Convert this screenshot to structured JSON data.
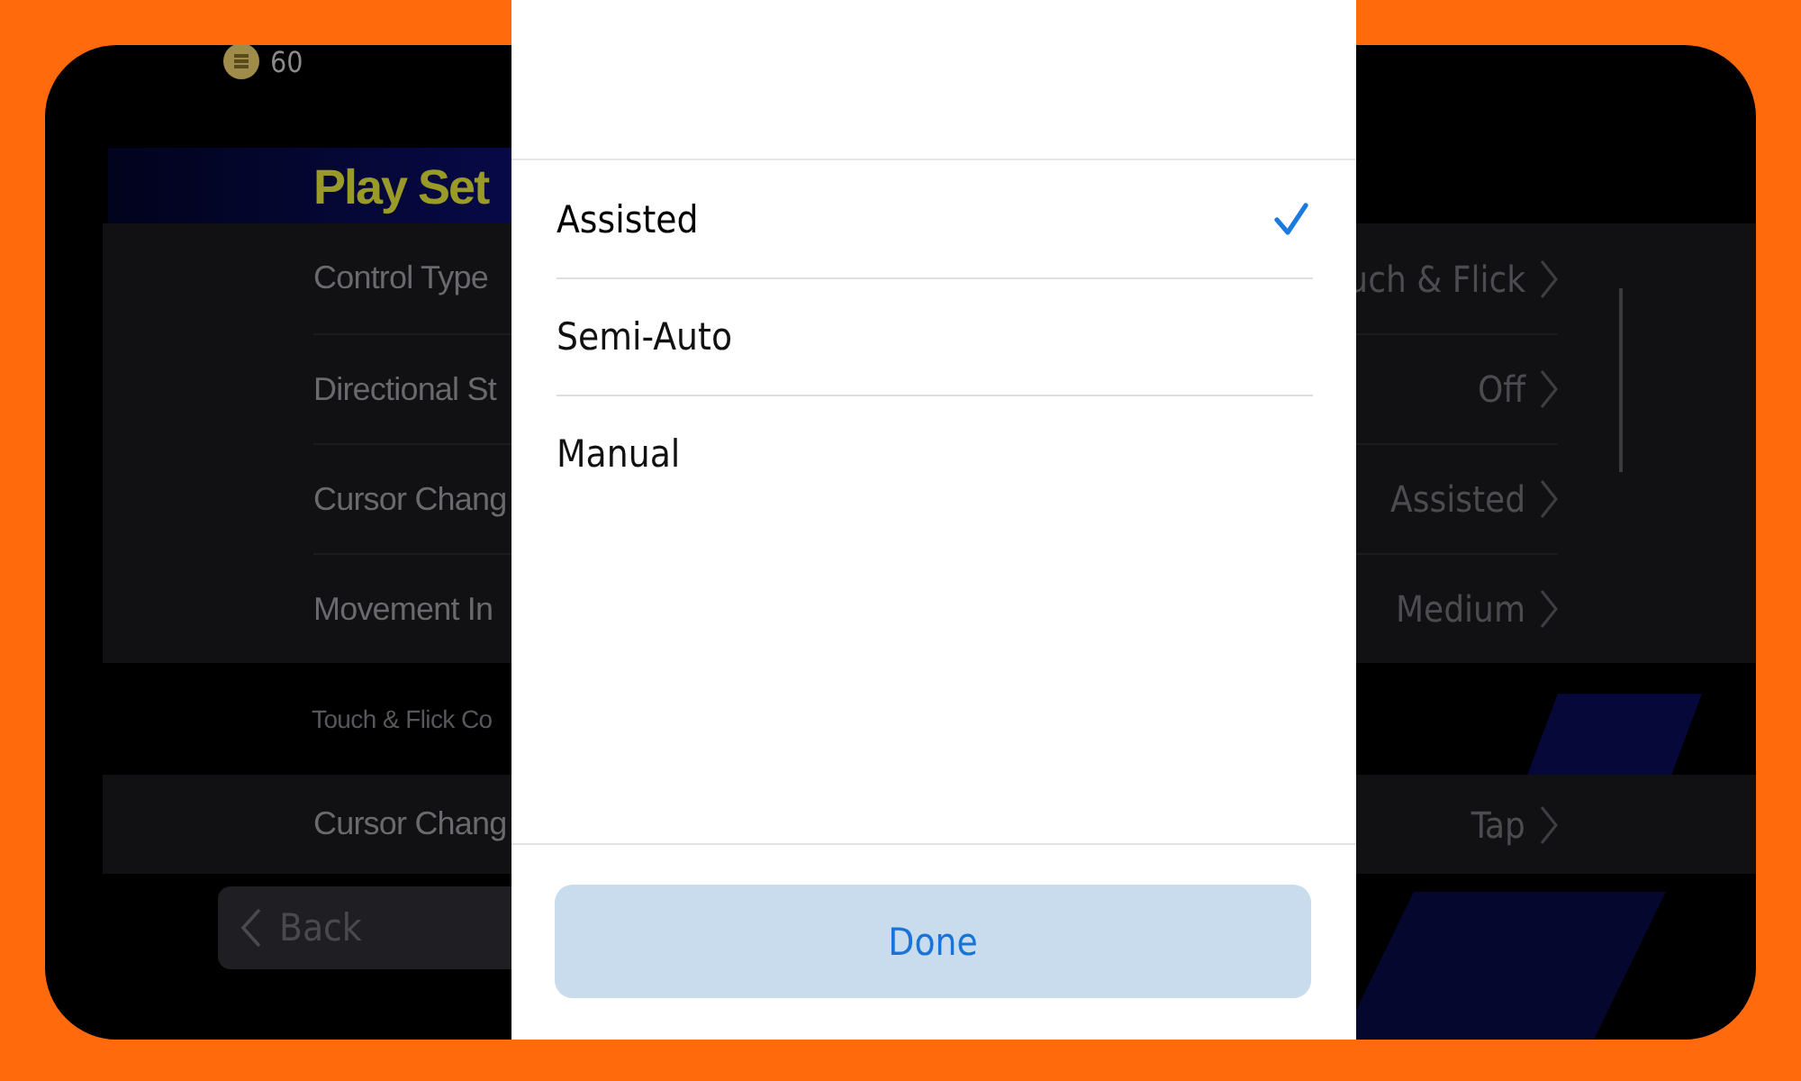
{
  "status": {
    "coins": "60"
  },
  "title": "Play Set",
  "settings": [
    {
      "label": "Control Type",
      "value": "uch & Flick"
    },
    {
      "label": "Directional St",
      "value": "Off"
    },
    {
      "label": "Cursor Chang",
      "value": "Assisted"
    },
    {
      "label": "Movement In",
      "value": "Medium"
    }
  ],
  "section": {
    "heading": "Touch & Flick Co",
    "settings": [
      {
        "label": "Cursor Chang",
        "value": "Tap"
      }
    ]
  },
  "back_button": "Back",
  "picker": {
    "options": [
      {
        "label": "Assisted",
        "selected": true
      },
      {
        "label": "Semi-Auto",
        "selected": false
      },
      {
        "label": "Manual",
        "selected": false
      }
    ],
    "done_button": "Done"
  }
}
